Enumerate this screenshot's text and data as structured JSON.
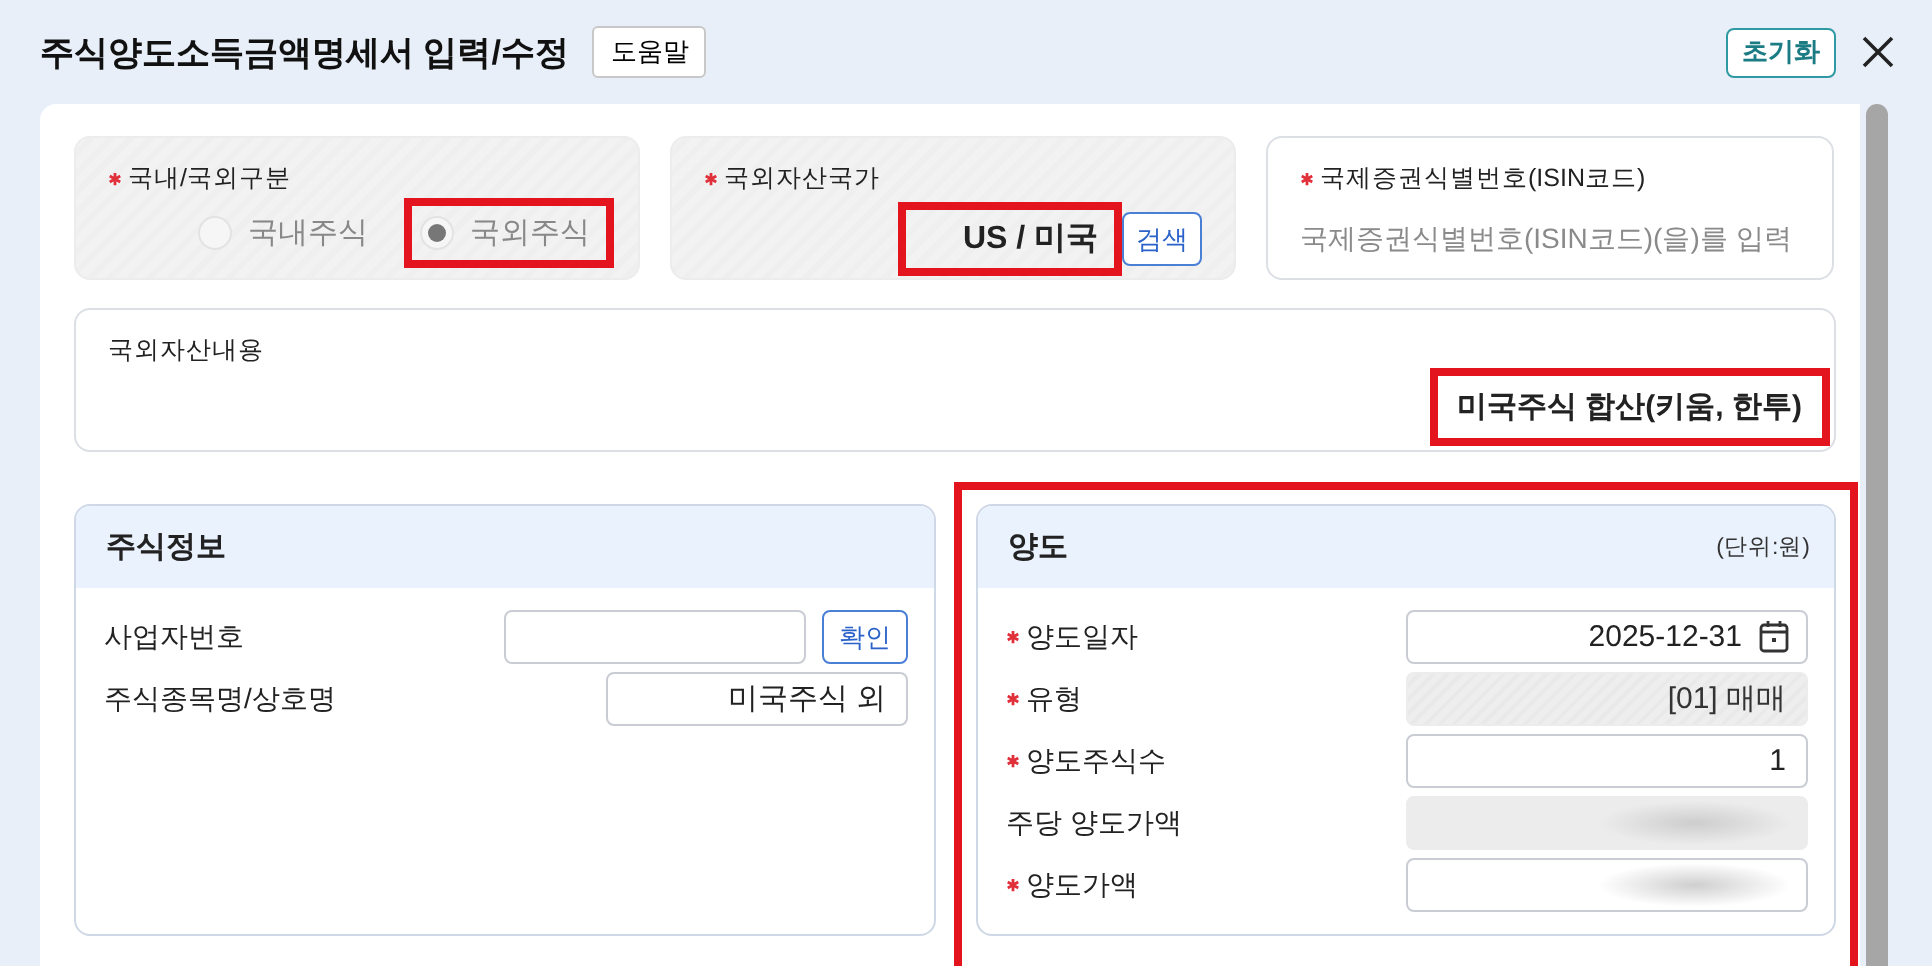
{
  "dialog": {
    "title": "주식양도소득금액명세서 입력/수정",
    "help_button": "도움말",
    "reset_button": "초기화"
  },
  "domestic_foreign": {
    "label": "국내/국외구분",
    "required": true,
    "disabled": true,
    "highlighted": true,
    "options": [
      {
        "label": "국내주식",
        "selected": false
      },
      {
        "label": "국외주식",
        "selected": true
      }
    ]
  },
  "country": {
    "label": "국외자산국가",
    "required": true,
    "disabled": true,
    "value": "US / 미국",
    "search_button": "검색",
    "highlighted": true
  },
  "isin": {
    "label": "국제증권식별번호(ISIN코드)",
    "required": true,
    "placeholder": "국제증권식별번호(ISIN코드)(을)를 입력"
  },
  "asset_content": {
    "label": "국외자산내용",
    "value": "미국주식 합산(키움, 한투)",
    "highlighted": true
  },
  "stock_info": {
    "title": "주식정보",
    "rows": [
      {
        "kind": "input_button",
        "label": "사업자번호",
        "button": "확인"
      },
      {
        "kind": "input",
        "label": "주식종목명/상호명",
        "value": "미국주식 외"
      }
    ]
  },
  "transfer": {
    "title": "양도",
    "unit": "(단위:원)",
    "highlighted": true,
    "rows": [
      {
        "kind": "date",
        "label": "양도일자",
        "required": true,
        "value": "2025-12-31"
      },
      {
        "kind": "input",
        "label": "유형",
        "required": true,
        "disabled": true,
        "value": "[01] 매매"
      },
      {
        "kind": "input",
        "label": "양도주식수",
        "required": true,
        "value": "1"
      },
      {
        "kind": "input",
        "label": "주당 양도가액",
        "required": false,
        "disabled": true,
        "redacted": true
      },
      {
        "kind": "input",
        "label": "양도가액",
        "required": true,
        "redacted": true
      }
    ]
  }
}
